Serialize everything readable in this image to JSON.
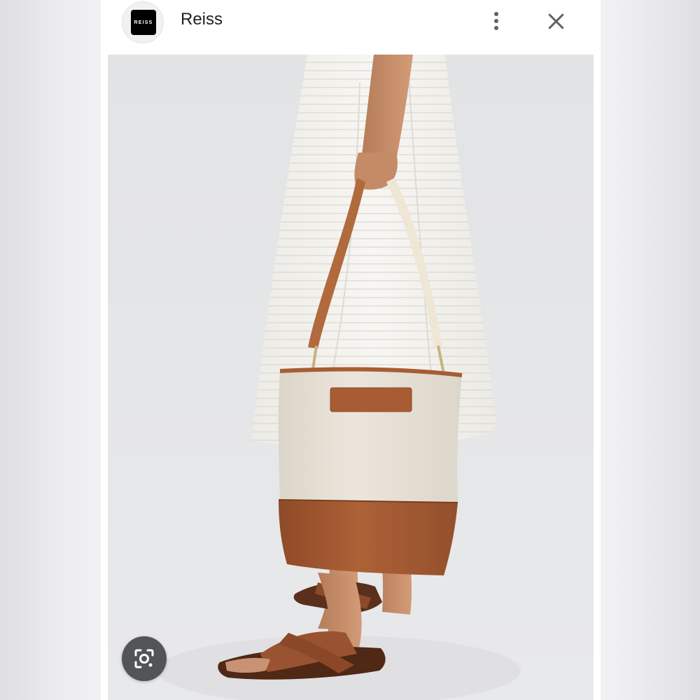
{
  "header": {
    "logo_text": "REISS",
    "site_name": "Reiss",
    "menu_icon": "more-vert-icon",
    "close_icon": "close-icon"
  },
  "photo": {
    "subject": "product-photo"
  },
  "lens_button": {
    "icon": "lens-search-icon"
  },
  "colors": {
    "leather": "#a85c33",
    "canvas": "#e8e1d6",
    "backdrop": "#e5e6e8",
    "lens_bg": "#535457"
  }
}
